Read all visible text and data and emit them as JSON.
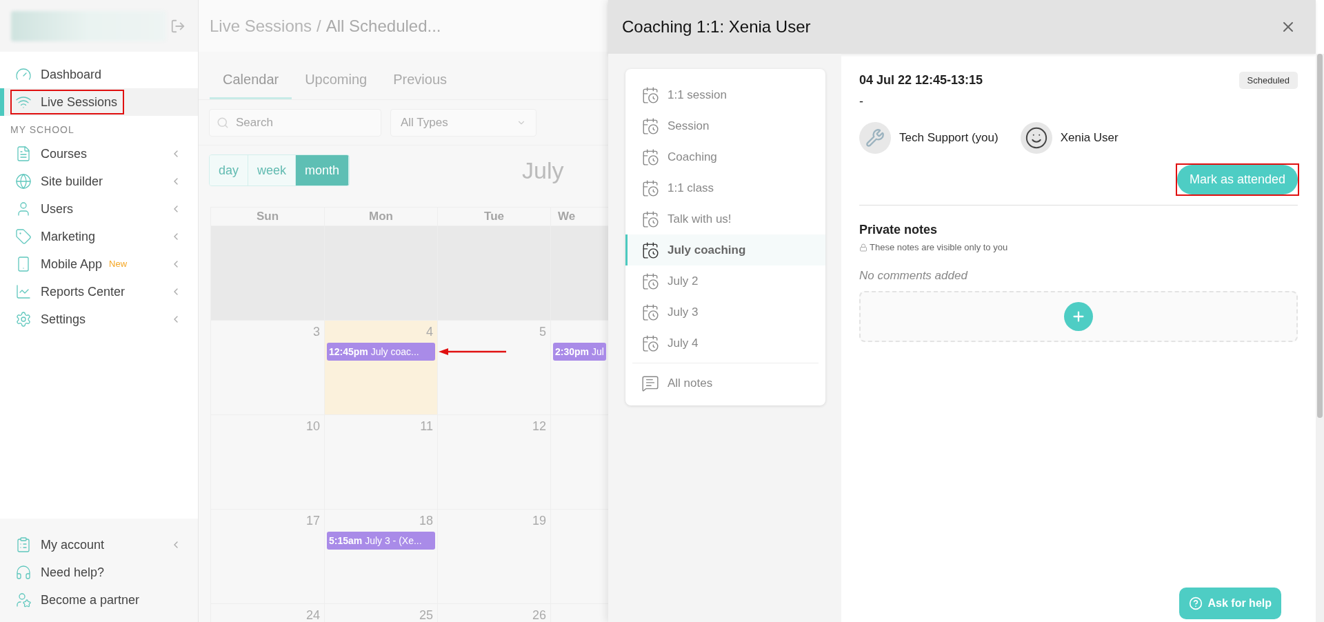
{
  "sidebar": {
    "top_items": [
      {
        "label": "Dashboard",
        "selected": false,
        "has_submenu": false,
        "annotated": false
      },
      {
        "label": "Live Sessions",
        "selected": true,
        "has_submenu": false,
        "annotated": true
      }
    ],
    "section_label": "MY SCHOOL",
    "school_items": [
      {
        "label": "Courses",
        "selected": false,
        "has_submenu": true
      },
      {
        "label": "Site builder",
        "selected": false,
        "has_submenu": true
      },
      {
        "label": "Users",
        "selected": false,
        "has_submenu": true
      },
      {
        "label": "Marketing",
        "selected": false,
        "has_submenu": true
      },
      {
        "label": "Mobile App",
        "badge": "New",
        "selected": false,
        "has_submenu": true
      },
      {
        "label": "Reports Center",
        "selected": false,
        "has_submenu": true
      },
      {
        "label": "Settings",
        "selected": false,
        "has_submenu": true
      }
    ],
    "bottom_items": [
      {
        "label": "My account",
        "has_submenu": true
      },
      {
        "label": "Need help?",
        "has_submenu": false
      },
      {
        "label": "Become a partner",
        "has_submenu": false
      }
    ]
  },
  "main": {
    "breadcrumb": {
      "parent": "Live Sessions",
      "separator": "/",
      "current": "All Scheduled..."
    },
    "tabs": [
      {
        "label": "Calendar",
        "selected": true
      },
      {
        "label": "Upcoming",
        "selected": false
      },
      {
        "label": "Previous",
        "selected": false
      }
    ],
    "search": {
      "placeholder": "Search"
    },
    "type_filter": {
      "value": "All Types"
    },
    "views": [
      {
        "label": "day",
        "selected": false
      },
      {
        "label": "week",
        "selected": false
      },
      {
        "label": "month",
        "selected": true
      }
    ],
    "calendar": {
      "title": "July",
      "weekdays": [
        "Sun",
        "Mon",
        "Tue",
        "We"
      ],
      "weeks": [
        {
          "days": [
            {
              "outside": true,
              "today": false
            },
            {
              "outside": true,
              "today": false
            },
            {
              "outside": true,
              "today": false
            },
            {
              "outside": true,
              "today": false
            }
          ]
        },
        {
          "days": [
            {
              "number": "3",
              "outside": false,
              "today": false
            },
            {
              "number": "4",
              "outside": false,
              "today": true,
              "events": [
                {
                  "time": "12:45pm",
                  "title": "July coac...",
                  "annotated": true
                }
              ]
            },
            {
              "number": "5",
              "outside": false,
              "today": false
            },
            {
              "outside": false,
              "today": false,
              "events": [
                {
                  "time": "2:30pm",
                  "title": "Jul",
                  "annotated": false
                }
              ]
            }
          ]
        },
        {
          "days": [
            {
              "number": "10",
              "outside": false,
              "today": false
            },
            {
              "number": "11",
              "outside": false,
              "today": false
            },
            {
              "number": "12",
              "outside": false,
              "today": false
            },
            {
              "outside": false,
              "today": false
            }
          ]
        },
        {
          "days": [
            {
              "number": "17",
              "outside": false,
              "today": false
            },
            {
              "number": "18",
              "outside": false,
              "today": false,
              "events": [
                {
                  "time": "5:15am",
                  "title": "July 3 - (Xe...",
                  "annotated": false
                }
              ]
            },
            {
              "number": "19",
              "outside": false,
              "today": false
            },
            {
              "outside": false,
              "today": false
            }
          ]
        },
        {
          "days": [
            {
              "number": "24",
              "outside": false,
              "today": false
            },
            {
              "number": "25",
              "outside": false,
              "today": false
            },
            {
              "number": "26",
              "outside": false,
              "today": false
            }
          ]
        }
      ]
    }
  },
  "modal": {
    "title": "Coaching 1:1: Xenia User",
    "sessions": [
      {
        "label": "1:1 session",
        "selected": false
      },
      {
        "label": "Session",
        "selected": false
      },
      {
        "label": "Coaching",
        "selected": false
      },
      {
        "label": "1:1 class",
        "selected": false
      },
      {
        "label": "Talk with us!",
        "selected": false
      },
      {
        "label": "July coaching",
        "selected": true
      },
      {
        "label": "July 2",
        "selected": false
      },
      {
        "label": "July 3",
        "selected": false
      },
      {
        "label": "July 4",
        "selected": false
      }
    ],
    "all_notes": "All notes",
    "details": {
      "datetime": "04 Jul 22 12:45-13:15",
      "status": "Scheduled",
      "description": "-",
      "participants": [
        {
          "name": "Tech Support (you)",
          "kind": "staff"
        },
        {
          "name": "Xenia User",
          "kind": "user"
        }
      ],
      "attend_button": {
        "label": "Mark as attended",
        "annotated": true
      }
    },
    "private_notes": {
      "title": "Private notes",
      "hint": "These notes are visible only to you",
      "empty": "No comments added"
    },
    "help_button": "Ask for help"
  }
}
